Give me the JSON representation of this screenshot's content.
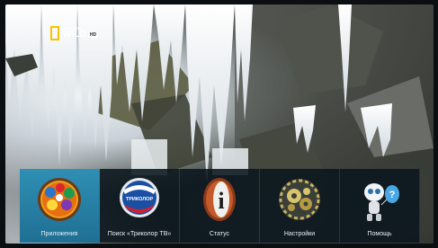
{
  "channel": {
    "logo_top": "NAT GEO",
    "logo_main": "WILD",
    "logo_hd": "HD",
    "accent_color": "#f5c400"
  },
  "menu": {
    "selected_index": 0,
    "items": [
      {
        "label": "Приложения",
        "icon": "apps-icon"
      },
      {
        "label": "Поиск «Триколор ТВ»",
        "icon": "tricolor-search-icon",
        "icon_text": "ТРИКОЛОР"
      },
      {
        "label": "Статус",
        "icon": "info-status-icon",
        "icon_text": "i"
      },
      {
        "label": "Настройки",
        "icon": "gears-settings-icon"
      },
      {
        "label": "Помощь",
        "icon": "robot-help-icon",
        "icon_text": "?"
      }
    ],
    "active_color": "#2f8fb4"
  }
}
